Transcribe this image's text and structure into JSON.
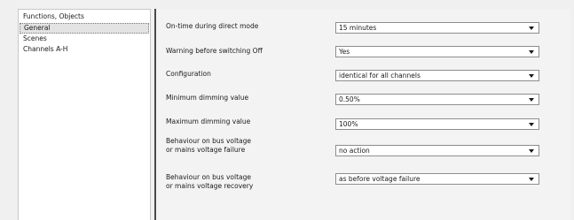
{
  "sidebar": {
    "items": [
      {
        "label": "Functions, Objects",
        "active": false
      },
      {
        "label": "General",
        "active": true
      },
      {
        "label": "Scenes",
        "active": false
      },
      {
        "label": "Channels A-H",
        "active": false
      }
    ]
  },
  "parameters": [
    {
      "label": [
        "On-time during direct mode"
      ],
      "value": "15 minutes"
    },
    {
      "label": [
        "Warning before switching Off"
      ],
      "value": "Yes"
    },
    {
      "label": [
        "Configuration"
      ],
      "value": "identical for all channels"
    },
    {
      "label": [
        "Minimum dimming value"
      ],
      "value": "0.50%"
    },
    {
      "label": [
        "Maximum dimming value"
      ],
      "value": "100%"
    },
    {
      "label": [
        "Behaviour on bus voltage",
        "or mains voltage failure"
      ],
      "value": "no action"
    },
    {
      "label": [
        "Behaviour on bus voltage",
        "or mains voltage recovery"
      ],
      "value": "as before voltage failure"
    }
  ]
}
